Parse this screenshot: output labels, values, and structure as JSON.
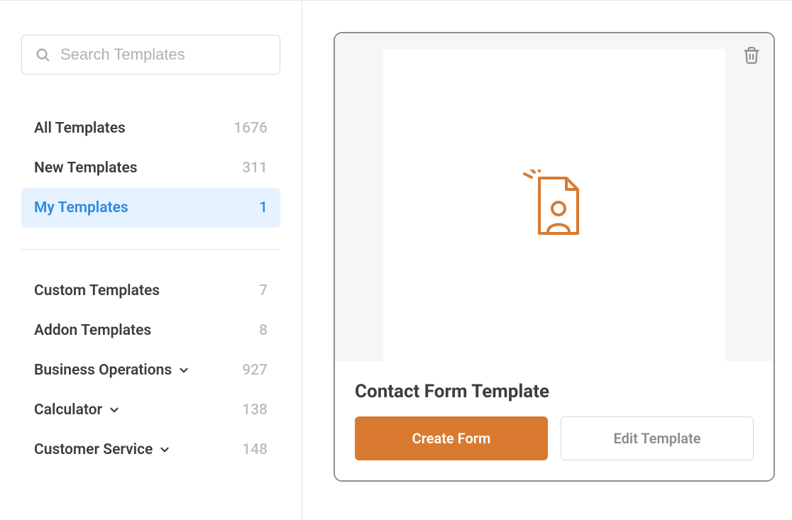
{
  "search": {
    "placeholder": "Search Templates"
  },
  "sidebar": {
    "groups": [
      {
        "label": "All Templates",
        "count": "1676",
        "expandable": false,
        "active": false
      },
      {
        "label": "New Templates",
        "count": "311",
        "expandable": false,
        "active": false
      },
      {
        "label": "My Templates",
        "count": "1",
        "expandable": false,
        "active": true
      }
    ],
    "categories": [
      {
        "label": "Custom Templates",
        "count": "7",
        "expandable": false
      },
      {
        "label": "Addon Templates",
        "count": "8",
        "expandable": false
      },
      {
        "label": "Business Operations",
        "count": "927",
        "expandable": true
      },
      {
        "label": "Calculator",
        "count": "138",
        "expandable": true
      },
      {
        "label": "Customer Service",
        "count": "148",
        "expandable": true
      }
    ]
  },
  "template": {
    "title": "Contact Form Template",
    "primary_label": "Create Form",
    "secondary_label": "Edit Template",
    "icon_name": "contact-form"
  },
  "colors": {
    "accent": "#d97a30",
    "active_blue": "#2b89e0",
    "active_bg": "#e6f2ff"
  }
}
